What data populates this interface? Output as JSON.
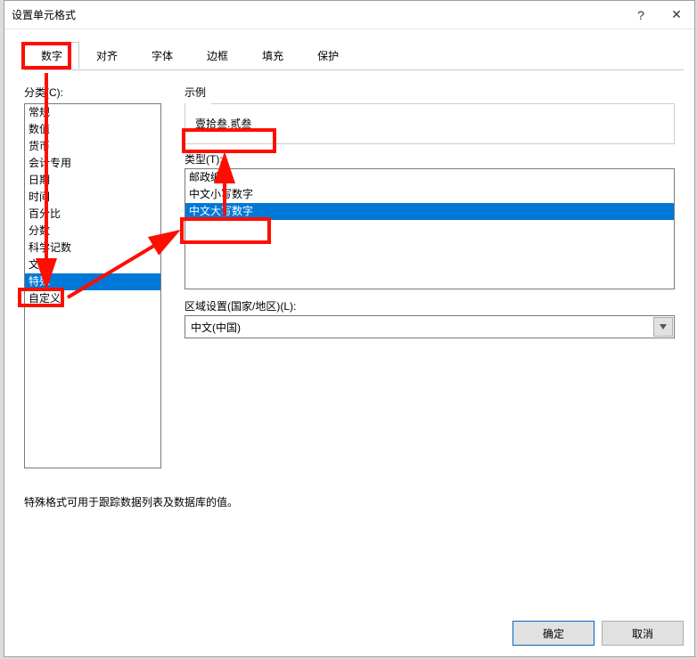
{
  "window": {
    "title": "设置单元格式",
    "help_icon": "?",
    "close_icon": "✕"
  },
  "tabs": {
    "items": [
      {
        "label": "数字",
        "active": true
      },
      {
        "label": "对齐"
      },
      {
        "label": "字体"
      },
      {
        "label": "边框"
      },
      {
        "label": "填充"
      },
      {
        "label": "保护"
      }
    ]
  },
  "category": {
    "label": "分类(C):",
    "items": [
      "常规",
      "数值",
      "货币",
      "会计专用",
      "日期",
      "时间",
      "百分比",
      "分数",
      "科学记数",
      "文本",
      "特殊",
      "自定义"
    ],
    "selected_index": 10
  },
  "sample": {
    "label": "示例",
    "value": "壹拾叁.贰叁"
  },
  "type": {
    "label": "类型(T):",
    "items": [
      "邮政编码",
      "中文小写数字",
      "中文大写数字"
    ],
    "selected_index": 2
  },
  "region": {
    "label": "区域设置(国家/地区)(L):",
    "value": "中文(中国)"
  },
  "description": "特殊格式可用于跟踪数据列表及数据库的值。",
  "footer": {
    "ok": "确定",
    "cancel": "取消"
  }
}
